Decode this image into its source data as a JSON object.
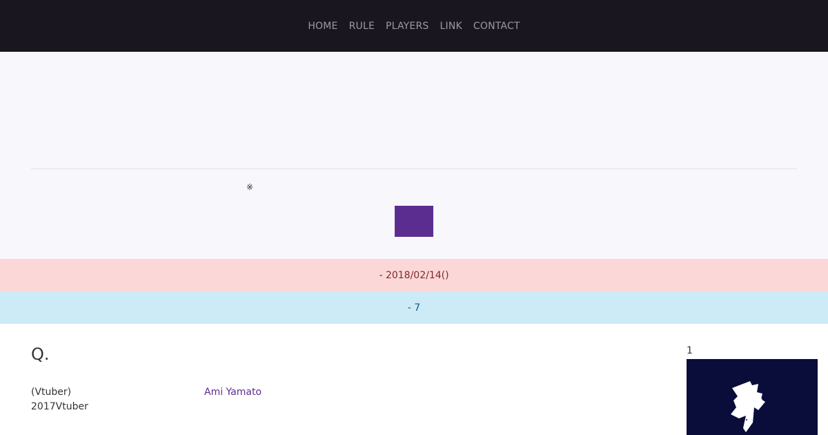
{
  "nav": {
    "items": [
      "HOME",
      "RULE",
      "PLAYERS",
      "LINK",
      "CONTACT"
    ]
  },
  "hero": {
    "note_mark": "※",
    "button_color": "#5c2d91"
  },
  "date_bar": {
    "text": "- 2018/02/14()"
  },
  "count_bar": {
    "text": "- 7"
  },
  "content": {
    "heading": "Q.",
    "description_lines": [
      "(Vtuber)",
      "2017Vtuber"
    ],
    "player_name": "Ami Yamato",
    "rank": "1"
  },
  "colors": {
    "navbar_bg": "#1a1620",
    "hero_bg": "#f8f7fc",
    "accent": "#5c2d91",
    "date_bar_bg": "#fbd8d7",
    "count_bar_bg": "#cdeaf7",
    "thumbnail_bg": "#0a0d3a"
  },
  "icons": {
    "thumbnail": "white-star-logo-icon"
  }
}
